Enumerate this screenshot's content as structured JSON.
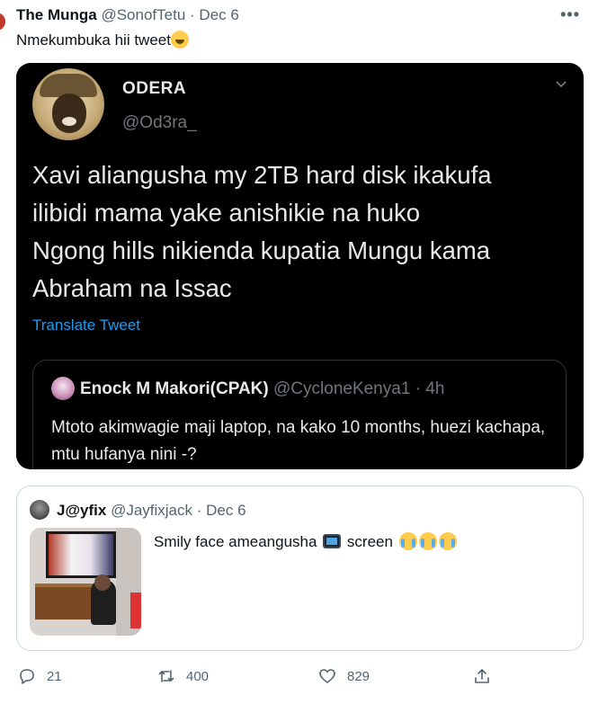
{
  "tweet": {
    "name": "The Munga",
    "handle": "@SonofTetu",
    "separator": "·",
    "date": "Dec 6",
    "text": "Nmekumbuka hii tweet",
    "more_label": "•••"
  },
  "quoted_odera": {
    "name": "ODERA",
    "handle": "@Od3ra_",
    "lines": [
      "Xavi aliangusha my 2TB hard disk ikakufa",
      "ilibidi mama yake anishikie  na huko",
      "Ngong hills nikienda kupatia Mungu kama",
      "Abraham na Issac"
    ],
    "translate_label": "Translate Tweet",
    "nested": {
      "name": "Enock M Makori(CPAK)",
      "handle": "@CycloneKenya1",
      "separator": "·",
      "time": "4h",
      "text": "Mtoto akimwagie maji laptop, na kako 10 months, huezi kachapa, mtu hufanya nini -?"
    }
  },
  "quoted_jay": {
    "name": "J@yfix",
    "handle": "@Jayfixjack",
    "separator": "·",
    "date": "Dec 6",
    "text_before": "Smily face ameangusha",
    "text_after": "screen"
  },
  "actions": {
    "replies": "21",
    "retweets": "400",
    "likes": "829"
  },
  "colors": {
    "accent": "#1d9bf0",
    "secondary_text": "#536471",
    "dark_card_bg": "#000000"
  }
}
